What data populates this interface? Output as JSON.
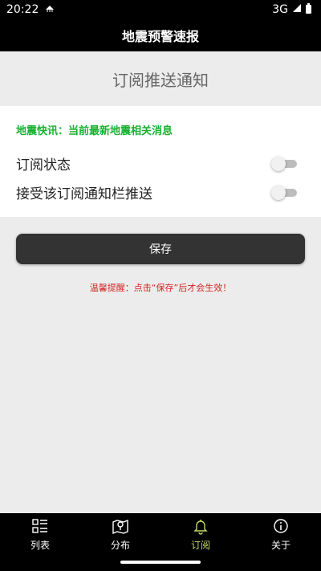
{
  "status": {
    "time": "20:22",
    "network": "3G"
  },
  "app_bar": {
    "title": "地震预警速报"
  },
  "page": {
    "heading": "订阅推送通知"
  },
  "card": {
    "notice": "地震快讯：当前最新地震相关消息",
    "rows": [
      {
        "label": "订阅状态",
        "enabled": false
      },
      {
        "label": "接受该订阅通知栏推送",
        "enabled": false
      }
    ]
  },
  "save_label": "保存",
  "tip": "温馨提醒：点击“保存”后才会生效！",
  "tabs": [
    {
      "label": "列表",
      "icon": "list-icon"
    },
    {
      "label": "分布",
      "icon": "map-icon"
    },
    {
      "label": "订阅",
      "icon": "bell-icon",
      "active": true
    },
    {
      "label": "关于",
      "icon": "info-icon"
    }
  ],
  "colors": {
    "accent": "#c8d86a",
    "notice": "#16b22f",
    "warning": "#d42424"
  }
}
